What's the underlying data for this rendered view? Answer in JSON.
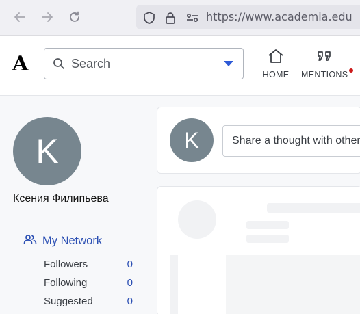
{
  "browser": {
    "url": "https://www.academia.edu",
    "icons": [
      "back-arrow-icon",
      "forward-arrow-icon",
      "reload-icon",
      "shield-icon",
      "lock-icon",
      "permissions-icon"
    ]
  },
  "header": {
    "logo": "A",
    "search": {
      "placeholder": "Search"
    },
    "nav": [
      {
        "label": "HOME",
        "icon": "home-icon"
      },
      {
        "label": "MENTIONS",
        "icon": "quote-icon"
      }
    ]
  },
  "profile": {
    "avatar_initial": "K",
    "name": "Ксения Филипьева"
  },
  "network": {
    "title": "My Network",
    "rows": [
      {
        "label": "Followers",
        "value": "0"
      },
      {
        "label": "Following",
        "value": "0"
      },
      {
        "label": "Suggested",
        "value": "0"
      }
    ]
  },
  "composer": {
    "avatar_initial": "K",
    "placeholder": "Share a thought with other"
  },
  "colors": {
    "avatar": "#77868f",
    "accent": "#2b4fb3",
    "notification": "#cc1a1a"
  }
}
